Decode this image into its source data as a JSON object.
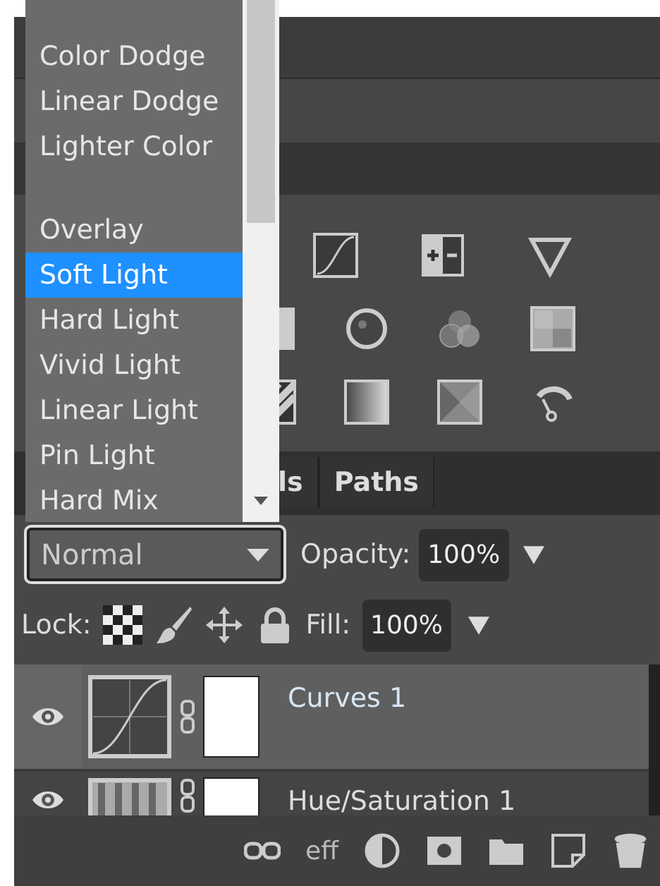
{
  "blend_menu": {
    "items": [
      {
        "kind": "option",
        "label": "Color Dodge",
        "selected": false
      },
      {
        "kind": "option",
        "label": "Linear Dodge",
        "selected": false
      },
      {
        "kind": "option",
        "label": "Lighter Color",
        "selected": false
      },
      {
        "kind": "gap"
      },
      {
        "kind": "option",
        "label": "Overlay",
        "selected": false
      },
      {
        "kind": "option",
        "label": "Soft Light",
        "selected": true
      },
      {
        "kind": "option",
        "label": "Hard Light",
        "selected": false
      },
      {
        "kind": "option",
        "label": "Vivid Light",
        "selected": false
      },
      {
        "kind": "option",
        "label": "Linear Light",
        "selected": false
      },
      {
        "kind": "option",
        "label": "Pin Light",
        "selected": false
      },
      {
        "kind": "option",
        "label": "Hard Mix",
        "selected": false
      }
    ]
  },
  "tabs": [
    {
      "label": "ls"
    },
    {
      "label": "Paths"
    }
  ],
  "blend_mode": {
    "value": "Normal"
  },
  "opacity": {
    "label": "Opacity:",
    "value": "100%"
  },
  "lock": {
    "label": "Lock:"
  },
  "fill": {
    "label": "Fill:",
    "value": "100%"
  },
  "layers": [
    {
      "kind": "curves",
      "name": "Curves 1",
      "selected": true,
      "visible": true
    },
    {
      "kind": "hue-saturation",
      "name": "Hue/Saturation 1",
      "selected": false,
      "visible": true
    }
  ],
  "footer": {
    "effects_label": "eff"
  }
}
